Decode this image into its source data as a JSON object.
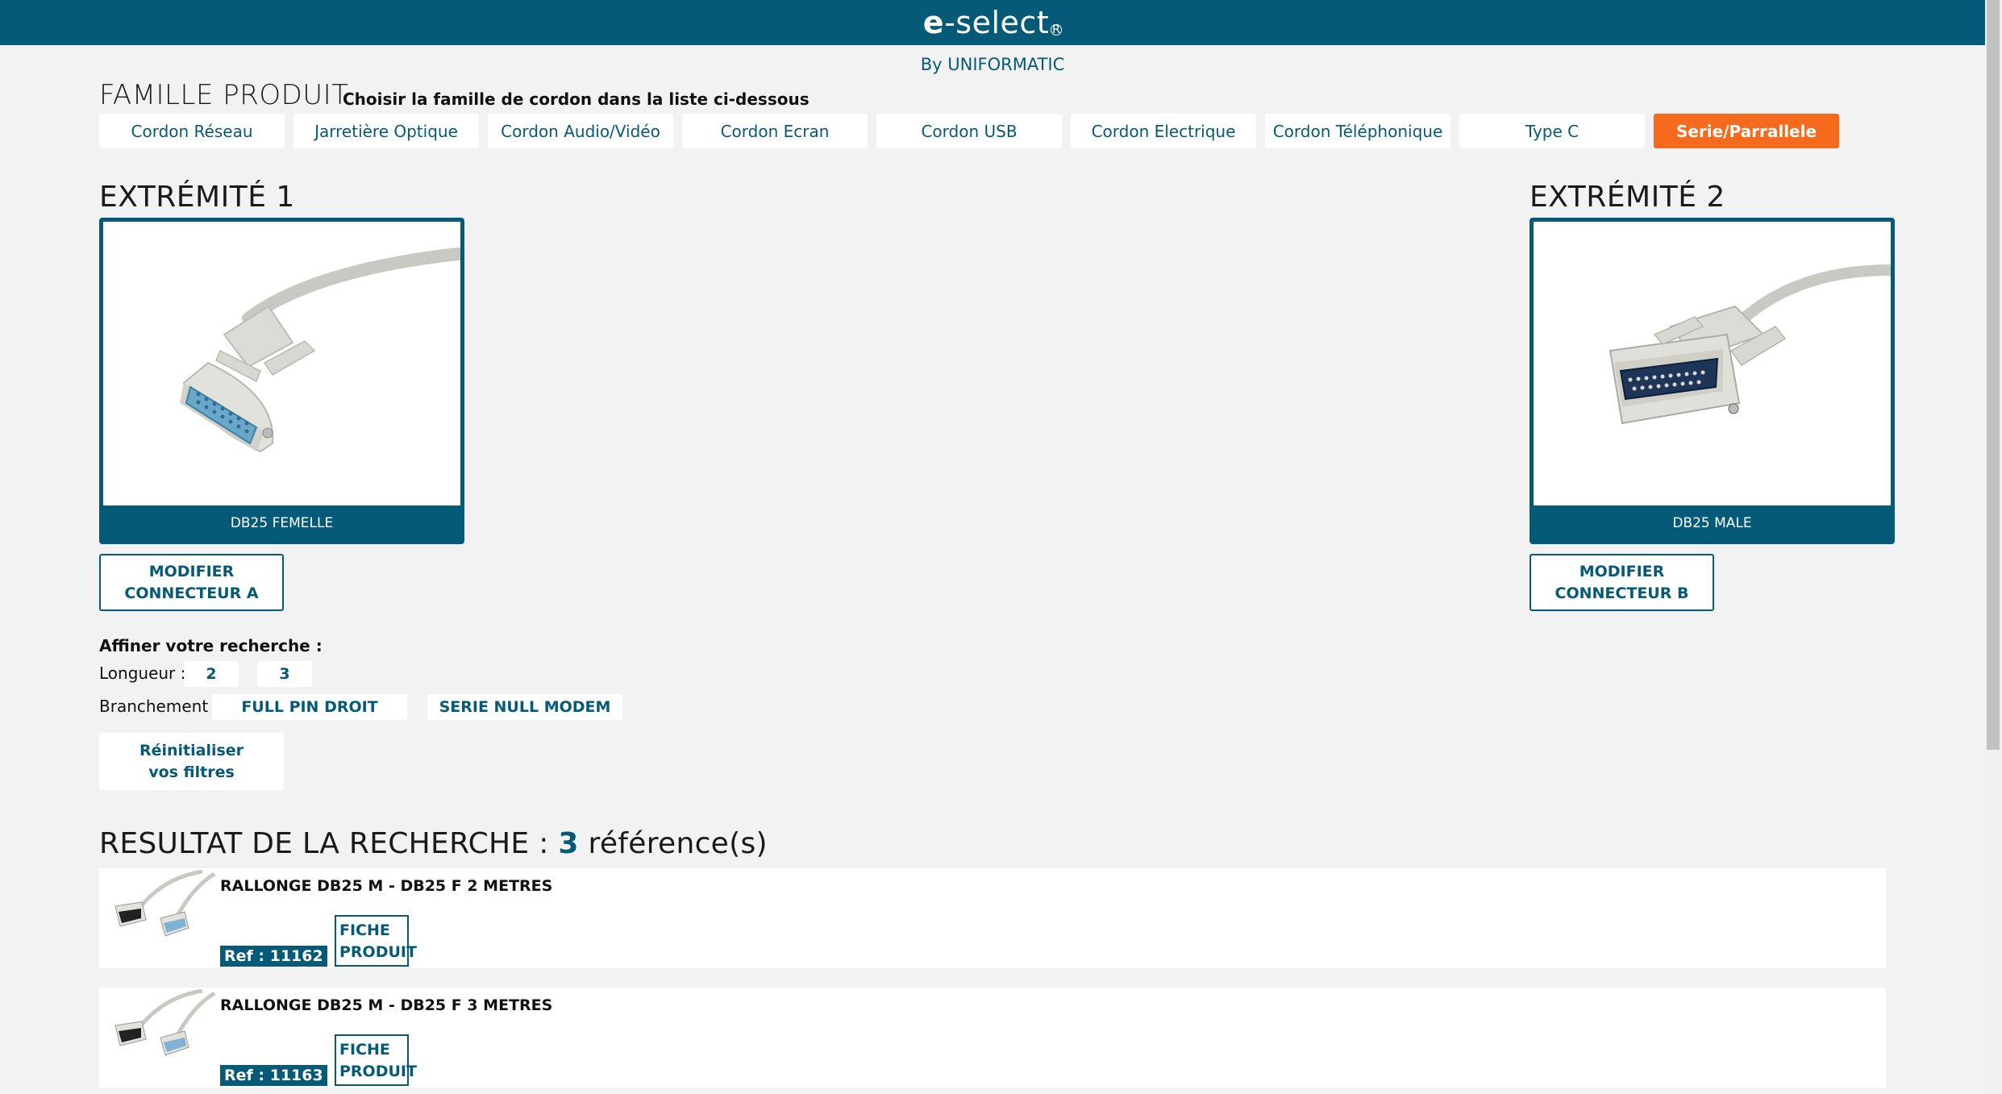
{
  "header": {
    "logo_bold": "e",
    "logo_rest": "-select",
    "logo_mark": "R",
    "byline": "By UNIFORMATIC"
  },
  "famille": {
    "title": "FAMILLE PRODUIT",
    "hint": "Choisir la famille de cordon dans la liste ci-dessous",
    "items": [
      {
        "label": "Cordon Réseau"
      },
      {
        "label": "Jarretière Optique"
      },
      {
        "label": "Cordon Audio/Vidéo"
      },
      {
        "label": "Cordon Ecran"
      },
      {
        "label": "Cordon USB"
      },
      {
        "label": "Cordon Electrique"
      },
      {
        "label": "Cordon Téléphonique"
      },
      {
        "label": "Type C"
      },
      {
        "label": "Serie/Parrallele"
      }
    ],
    "active_index": 8
  },
  "extremite1": {
    "title": "EXTRÉMITÉ 1",
    "label": "DB25 FEMELLE",
    "modify": "MODIFIER CONNECTEUR A"
  },
  "extremite2": {
    "title": "EXTRÉMITÉ 2",
    "label": "DB25 MALE",
    "modify": "MODIFIER CONNECTEUR B"
  },
  "filters": {
    "title": "Affiner votre recherche :",
    "longueur_label": "Longueur :",
    "longueur_options": [
      "2",
      "3"
    ],
    "branchement_label": "Branchement :",
    "branchement_options": [
      "FULL PIN DROIT",
      "SERIE NULL MODEM"
    ],
    "reset": "Réinitialiser vos filtres"
  },
  "results": {
    "title_prefix": "RESULTAT DE LA RECHERCHE :",
    "count": "3",
    "title_suffix": "référence(s)",
    "items": [
      {
        "name": "RALLONGE DB25 M - DB25 F 2 METRES",
        "ref": "Ref : 11162",
        "fiche": "FICHE PRODUIT"
      },
      {
        "name": "RALLONGE DB25 M - DB25 F 3 METRES",
        "ref": "Ref : 11163",
        "fiche": "FICHE PRODUIT"
      }
    ]
  },
  "colors": {
    "primary": "#055a78",
    "active": "#f56a1d",
    "background": "#f2f2f2"
  }
}
